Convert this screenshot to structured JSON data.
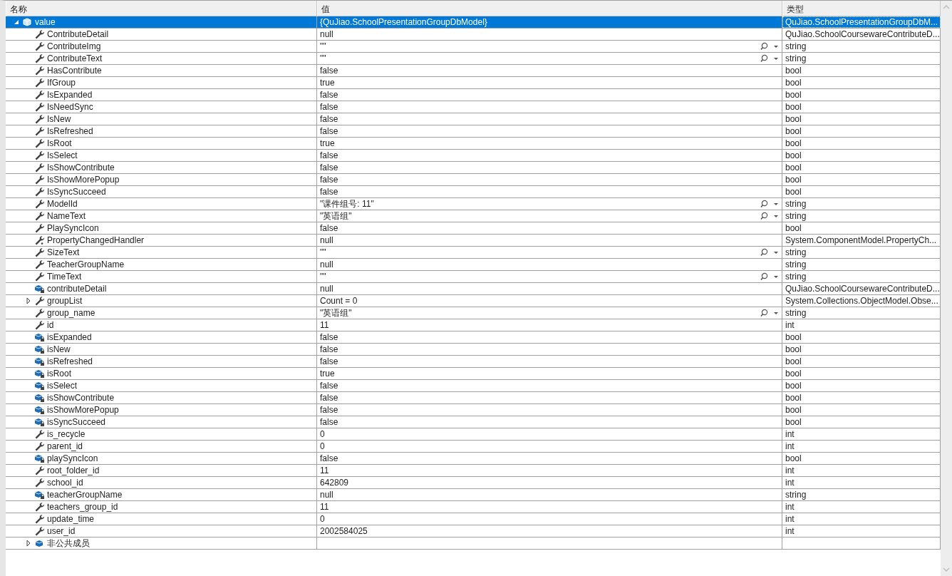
{
  "columns": [
    "名称",
    "值",
    "类型"
  ],
  "rows": [
    {
      "name": "value",
      "value": "{QuJiao.SchoolPresentationGroupDbModel}",
      "type": "QuJiao.SchoolPresentationGroupDbM...",
      "kind": "object",
      "selected": true,
      "expanded": true,
      "children": [
        {
          "name": "ContributeDetail",
          "value": "null",
          "type": "QuJiao.SchoolCoursewareContributeD...",
          "kind": "property",
          "selected": false
        },
        {
          "name": "ContributeImg",
          "value": "\"\"",
          "type": "string",
          "kind": "property",
          "selected": false,
          "visualizer": true
        },
        {
          "name": "ContributeText",
          "value": "\"\"",
          "type": "string",
          "kind": "property",
          "selected": false,
          "visualizer": true
        },
        {
          "name": "HasContribute",
          "value": "false",
          "type": "bool",
          "kind": "property",
          "selected": false
        },
        {
          "name": "IfGroup",
          "value": "true",
          "type": "bool",
          "kind": "property",
          "selected": false
        },
        {
          "name": "IsExpanded",
          "value": "false",
          "type": "bool",
          "kind": "property",
          "selected": false
        },
        {
          "name": "IsNeedSync",
          "value": "false",
          "type": "bool",
          "kind": "property",
          "selected": false
        },
        {
          "name": "IsNew",
          "value": "false",
          "type": "bool",
          "kind": "property",
          "selected": false
        },
        {
          "name": "IsRefreshed",
          "value": "false",
          "type": "bool",
          "kind": "property",
          "selected": false
        },
        {
          "name": "IsRoot",
          "value": "true",
          "type": "bool",
          "kind": "property",
          "selected": false
        },
        {
          "name": "IsSelect",
          "value": "false",
          "type": "bool",
          "kind": "property",
          "selected": false
        },
        {
          "name": "IsShowContribute",
          "value": "false",
          "type": "bool",
          "kind": "property",
          "selected": false
        },
        {
          "name": "IsShowMorePopup",
          "value": "false",
          "type": "bool",
          "kind": "property",
          "selected": false
        },
        {
          "name": "IsSyncSucceed",
          "value": "false",
          "type": "bool",
          "kind": "property",
          "selected": false
        },
        {
          "name": "ModelId",
          "value": "\"课件组号: 11\"",
          "type": "string",
          "kind": "property",
          "selected": false,
          "visualizer": true
        },
        {
          "name": "NameText",
          "value": "\"英语组\"",
          "type": "string",
          "kind": "property",
          "selected": false,
          "visualizer": true
        },
        {
          "name": "PlaySyncIcon",
          "value": "false",
          "type": "bool",
          "kind": "property",
          "selected": false
        },
        {
          "name": "PropertyChangedHandler",
          "value": "null",
          "type": "System.ComponentModel.PropertyCh...",
          "kind": "event",
          "selected": false
        },
        {
          "name": "SizeText",
          "value": "\"\"",
          "type": "string",
          "kind": "property",
          "selected": false,
          "visualizer": true
        },
        {
          "name": "TeacherGroupName",
          "value": "null",
          "type": "string",
          "kind": "property",
          "selected": false
        },
        {
          "name": "TimeText",
          "value": "\"\"",
          "type": "string",
          "kind": "property",
          "selected": false,
          "visualizer": true
        },
        {
          "name": "contributeDetail",
          "value": "null",
          "type": "QuJiao.SchoolCoursewareContributeD...",
          "kind": "field",
          "selected": false
        },
        {
          "name": "groupList",
          "value": "Count = 0",
          "type": "System.Collections.ObjectModel.Obse...",
          "kind": "property",
          "selected": false,
          "expanded": false
        },
        {
          "name": "group_name",
          "value": "\"英语组\"",
          "type": "string",
          "kind": "property",
          "selected": false,
          "visualizer": true
        },
        {
          "name": "id",
          "value": "11",
          "type": "int",
          "kind": "property",
          "selected": false
        },
        {
          "name": "isExpanded",
          "value": "false",
          "type": "bool",
          "kind": "field",
          "selected": false
        },
        {
          "name": "isNew",
          "value": "false",
          "type": "bool",
          "kind": "field",
          "selected": false
        },
        {
          "name": "isRefreshed",
          "value": "false",
          "type": "bool",
          "kind": "field",
          "selected": false
        },
        {
          "name": "isRoot",
          "value": "true",
          "type": "bool",
          "kind": "field",
          "selected": false
        },
        {
          "name": "isSelect",
          "value": "false",
          "type": "bool",
          "kind": "field",
          "selected": false
        },
        {
          "name": "isShowContribute",
          "value": "false",
          "type": "bool",
          "kind": "field",
          "selected": false
        },
        {
          "name": "isShowMorePopup",
          "value": "false",
          "type": "bool",
          "kind": "field",
          "selected": false
        },
        {
          "name": "isSyncSucceed",
          "value": "false",
          "type": "bool",
          "kind": "field",
          "selected": false
        },
        {
          "name": "is_recycle",
          "value": "0",
          "type": "int",
          "kind": "property",
          "selected": false
        },
        {
          "name": "parent_id",
          "value": "0",
          "type": "int",
          "kind": "property",
          "selected": false
        },
        {
          "name": "playSyncIcon",
          "value": "false",
          "type": "bool",
          "kind": "field",
          "selected": false
        },
        {
          "name": "root_folder_id",
          "value": "11",
          "type": "int",
          "kind": "property",
          "selected": false
        },
        {
          "name": "school_id",
          "value": "642809",
          "type": "int",
          "kind": "property",
          "selected": false
        },
        {
          "name": "teacherGroupName",
          "value": "null",
          "type": "string",
          "kind": "field",
          "selected": false
        },
        {
          "name": "teachers_group_id",
          "value": "11",
          "type": "int",
          "kind": "property",
          "selected": false
        },
        {
          "name": "update_time",
          "value": "0",
          "type": "int",
          "kind": "property",
          "selected": false
        },
        {
          "name": "user_id",
          "value": "2002584025",
          "type": "int",
          "kind": "property",
          "selected": false
        },
        {
          "name": "非公共成员",
          "kind": "group",
          "selected": false,
          "expanded": false
        }
      ]
    }
  ]
}
